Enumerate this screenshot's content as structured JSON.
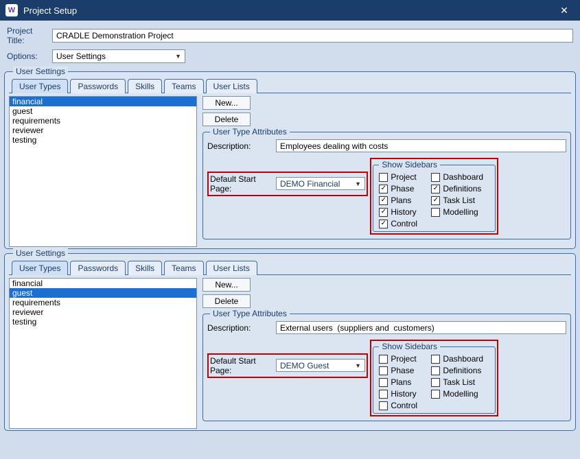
{
  "window": {
    "app_icon": "W",
    "title": "Project Setup"
  },
  "form": {
    "project_title_label": "Project Title:",
    "project_title": "CRADLE Demonstration Project",
    "options_label": "Options:",
    "options_selected": "User Settings"
  },
  "tabs": {
    "user_types": "User Types",
    "passwords": "Passwords",
    "skills": "Skills",
    "teams": "Teams",
    "user_lists": "User Lists"
  },
  "buttons": {
    "new": "New...",
    "delete": "Delete"
  },
  "groups": {
    "user_settings_legend": "User Settings",
    "user_type_attributes_legend": "User Type Attributes",
    "show_sidebars_legend": "Show Sidebars"
  },
  "attr_labels": {
    "description": "Description:",
    "default_start_page": "Default Start Page:"
  },
  "list_items": [
    "financial",
    "guest",
    "requirements",
    "reviewer",
    "testing"
  ],
  "sidebars": {
    "project": "Project",
    "dashboard": "Dashboard",
    "phase": "Phase",
    "definitions": "Definitions",
    "plans": "Plans",
    "task_list": "Task List",
    "history": "History",
    "modelling": "Modelling",
    "control": "Control"
  },
  "panel1": {
    "selected": "financial",
    "description": "Employees dealing with costs",
    "start_page": "DEMO Financial",
    "checks": {
      "project": false,
      "dashboard": false,
      "phase": true,
      "definitions": true,
      "plans": true,
      "task_list": true,
      "history": true,
      "modelling": false,
      "control": true
    }
  },
  "panel2": {
    "selected": "guest",
    "description": "External users  (suppliers and  customers)",
    "start_page": "DEMO Guest",
    "checks": {
      "project": false,
      "dashboard": false,
      "phase": false,
      "definitions": false,
      "plans": false,
      "task_list": false,
      "history": false,
      "modelling": false,
      "control": false
    }
  }
}
